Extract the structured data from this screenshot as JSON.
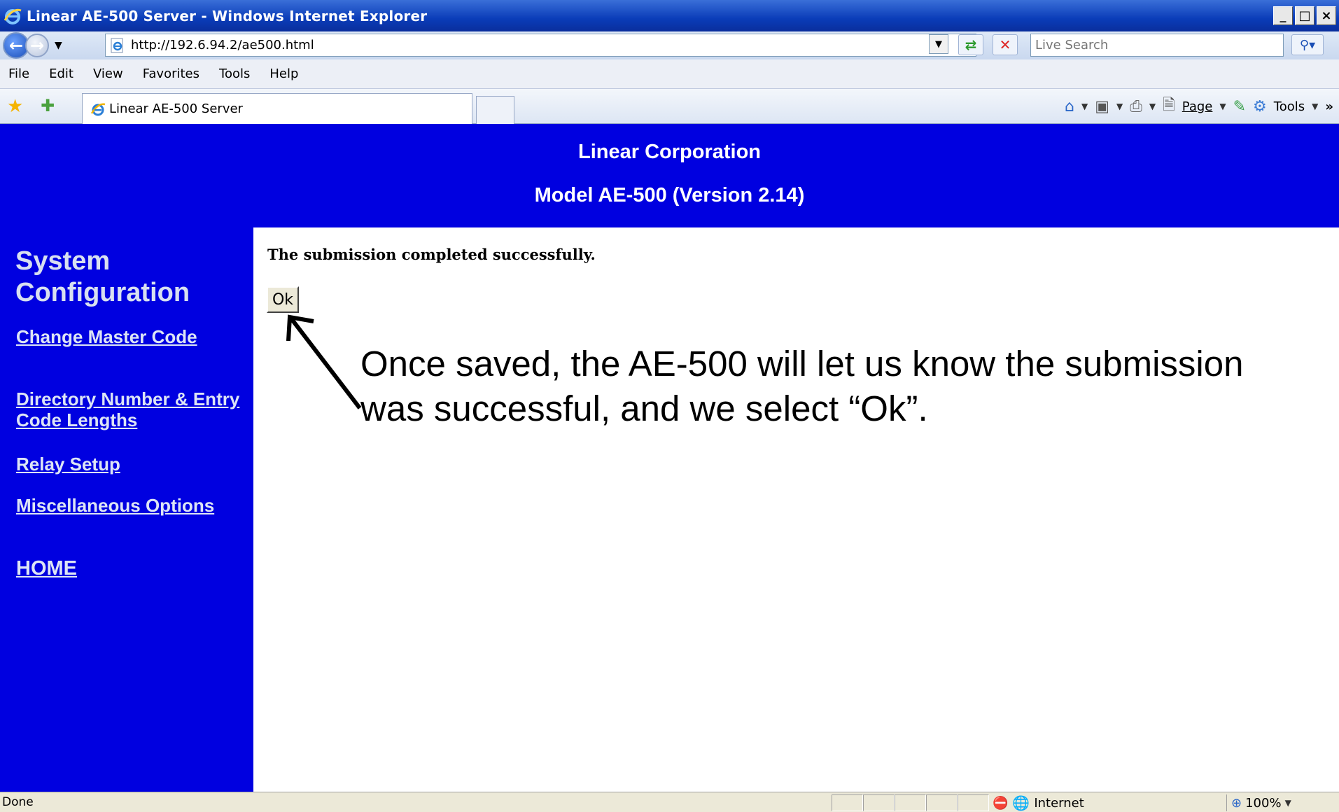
{
  "window": {
    "title": "Linear AE-500 Server - Windows Internet Explorer",
    "minimize": "_",
    "maximize": "□",
    "close": "×"
  },
  "address_bar": {
    "url": "http://192.6.94.2/ae500.html",
    "search_placeholder": "Live Search"
  },
  "menu": {
    "items": [
      "File",
      "Edit",
      "View",
      "Favorites",
      "Tools",
      "Help"
    ]
  },
  "tabs": {
    "active_label": "Linear AE-500 Server"
  },
  "command_bar": {
    "page_label": "Page",
    "tools_label": "Tools",
    "overflow": "»"
  },
  "page": {
    "header_line1": "Linear Corporation",
    "header_line2": "Model AE-500 (Version 2.14)",
    "sidebar_title": "System Configuration",
    "sidebar_links": [
      "Change Master Code",
      "Directory Number & Entry Code Lengths",
      "Relay Setup",
      "Miscellaneous Options",
      "HOME"
    ],
    "message": "The submission completed successfully.",
    "ok_button": "Ok"
  },
  "annotation": {
    "text": "Once saved, the AE-500 will let us know the submission was successful, and we select “Ok”."
  },
  "status_bar": {
    "status": "Done",
    "zone": "Internet",
    "zoom": "100%"
  },
  "colors": {
    "page_blue": "#0000e0",
    "title_bar": "#0a3cb8"
  }
}
